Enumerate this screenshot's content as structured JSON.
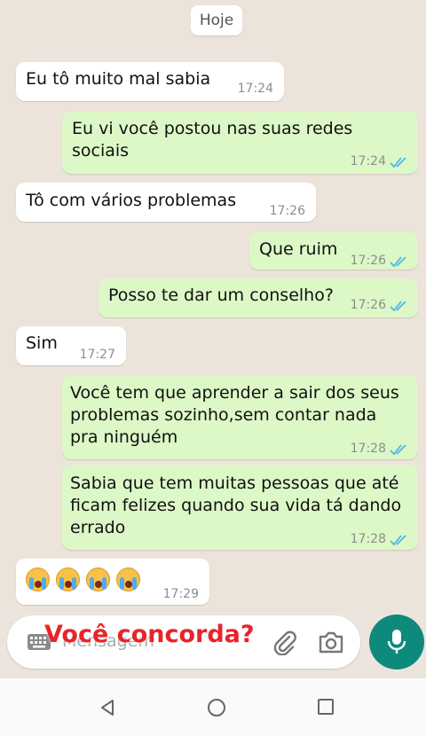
{
  "date_chip": "Hoje",
  "messages": [
    {
      "dir": "in",
      "text": "Eu tô muito mal sabia",
      "time": "17:24"
    },
    {
      "dir": "out",
      "text": "Eu vi você postou nas suas redes\nsociais",
      "time": "17:24"
    },
    {
      "dir": "in",
      "text": "Tô com vários problemas",
      "time": "17:26"
    },
    {
      "dir": "out",
      "text": "Que ruim",
      "time": "17:26"
    },
    {
      "dir": "out",
      "text": "Posso te dar um conselho?",
      "time": "17:26"
    },
    {
      "dir": "in",
      "text": "Sim",
      "time": "17:27"
    },
    {
      "dir": "out",
      "text": "Você tem que aprender a sair dos seus\nproblemas sozinho,sem contar nada\npra ninguém",
      "time": "17:28"
    },
    {
      "dir": "out",
      "text": "Sabia que tem muitas pessoas que até\nficam felizes quando sua vida tá dando\nerrado",
      "time": "17:28"
    },
    {
      "dir": "in",
      "text": "",
      "time": "17:29",
      "emoji": "loudly-crying-face",
      "emoji_count": 4
    }
  ],
  "input": {
    "placeholder": "Mensagem",
    "overlay_caption": "Você concorda?"
  },
  "icons": {
    "keyboard": "keyboard-icon",
    "attach": "paperclip-icon",
    "camera": "camera-icon",
    "mic": "microphone-icon",
    "read_receipt": "double-check-icon",
    "nav_back": "triangle-back-icon",
    "nav_home": "circle-home-icon",
    "nav_recents": "square-recents-icon"
  },
  "colors": {
    "chat_bg": "#ece3da",
    "incoming_bubble": "#ffffff",
    "outgoing_bubble": "#dcf8c6",
    "read_ticks": "#4fb6ec",
    "mic_button": "#0d8a7c",
    "overlay_caption": "#e8242a"
  }
}
